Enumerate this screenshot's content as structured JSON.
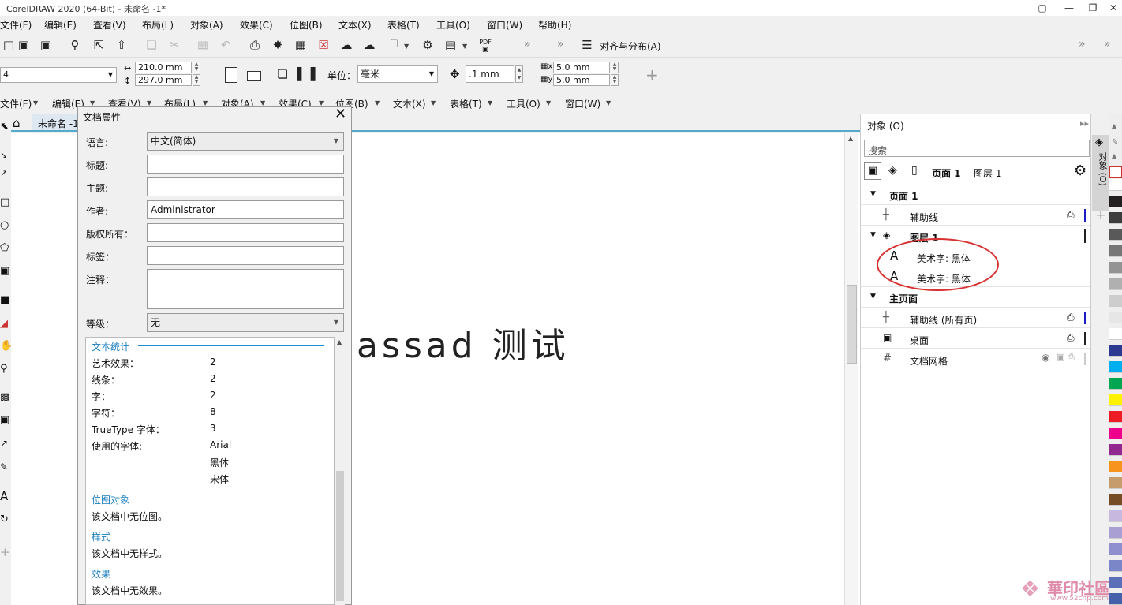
{
  "window": {
    "title": "CorelDRAW 2020 (64-Bit) - 未命名 -1*"
  },
  "menu": [
    "文件(F)",
    "编辑(E)",
    "查看(V)",
    "布局(L)",
    "对象(A)",
    "效果(C)",
    "位图(B)",
    "文本(X)",
    "表格(T)",
    "工具(O)",
    "窗口(W)",
    "帮助(H)"
  ],
  "toolbar": {
    "pdf_label": "PDF",
    "align_label": "对齐与分布(A)"
  },
  "propbar": {
    "page_size": "4",
    "width": "210.0 mm",
    "height": "297.0 mm",
    "unit_label": "单位：",
    "unit_value": "毫米",
    "nudge": ".1 mm",
    "dup_x": "5.0 mm",
    "dup_y": "5.0 mm"
  },
  "menu2": [
    "文件(F)",
    "编辑(E)",
    "查看(V)",
    "布局(L)",
    "对象(A)",
    "效果(C)",
    "位图(B)",
    "文本(X)",
    "表格(T)",
    "工具(O)",
    "窗口(W)"
  ],
  "doc_tab": "未命名 -1",
  "canvas_text": "assad 测试",
  "dialog": {
    "title": "文档属性",
    "language_label": "语言:",
    "language_value": "中文(简体)",
    "title_label": "标题:",
    "subject_label": "主题:",
    "author_label": "作者:",
    "author_value": "Administrator",
    "copyright_label": "版权所有：",
    "tags_label": "标签：",
    "notes_label": "注释：",
    "rating_label": "等级：",
    "rating_value": "无",
    "stats": {
      "text_section": "文本统计",
      "rows": [
        {
          "label": "艺术效果：",
          "value": "2"
        },
        {
          "label": "线条：",
          "value": "2"
        },
        {
          "label": "字：",
          "value": "2"
        },
        {
          "label": "字符：",
          "value": "8"
        },
        {
          "label": "TrueType 字体：",
          "value": "3"
        },
        {
          "label": "使用的字体:",
          "value": "Arial"
        },
        {
          "label": "",
          "value": "黑体"
        },
        {
          "label": "",
          "value": "宋体"
        }
      ],
      "bitmap_section": "位图对象",
      "bitmap_text": "该文档中无位图。",
      "style_section": "样式",
      "style_text": "该文档中无样式。",
      "effect_section": "效果",
      "effect_text": "该文档中无效果。"
    }
  },
  "objects": {
    "title": "对象 (O)",
    "search_placeholder": "搜索",
    "page_tab": "页面 1",
    "layer_tab": "图层 1",
    "tree": {
      "page1": "页面 1",
      "guides": "辅助线",
      "layer1": "图层 1",
      "art_text_1": "美术字: 黑体",
      "art_text_2": "美术字: 黑体",
      "master": "主页面",
      "guides_all": "辅助线 (所有页)",
      "desktop": "桌面",
      "grid": "文档网格"
    },
    "side_tab_label": "对象 (O)"
  },
  "palette_colors": [
    "#ffffff",
    "#231f20",
    "#3c3c3c",
    "#595959",
    "#767676",
    "#939393",
    "#b0b0b0",
    "#cdcdcd",
    "#e6e6e6",
    "#ffffff",
    "#2b3990",
    "#00aeef",
    "#00a651",
    "#fff200",
    "#ed1c24",
    "#ec008c",
    "#92278f",
    "#f7941d",
    "#c69c6d",
    "#754c24",
    "#c7b8e0",
    "#a99fd3",
    "#8f8fd0",
    "#7a86c8",
    "#5a6fb8",
    "#4460a8",
    "#3a6fb0",
    "#2c86c0"
  ],
  "watermark": {
    "brand": "華印社區",
    "url": "www.52cnp.com"
  }
}
